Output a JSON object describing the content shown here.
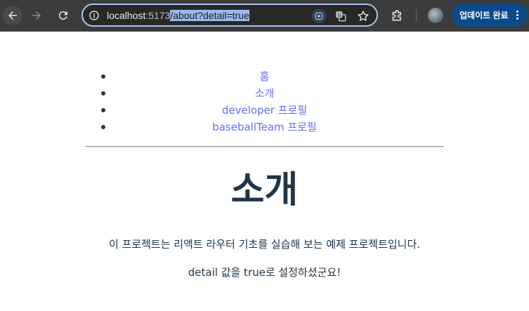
{
  "browser": {
    "url_host": "localhost",
    "url_port": ":5173",
    "url_path": "/about?detail=true",
    "update_button": "업데이트 완료",
    "icons": [
      "back-arrow-icon",
      "forward-arrow-icon",
      "reload-icon",
      "info-icon",
      "lens-icon",
      "translate-icon",
      "star-icon",
      "extensions-icon",
      "avatar",
      "kebab-menu-icon"
    ],
    "accent": "#0b4a8b"
  },
  "nav": {
    "items": [
      {
        "label": "홈"
      },
      {
        "label": "소개"
      },
      {
        "label": "developer 프로필"
      },
      {
        "label": "baseballTeam 프로필"
      }
    ],
    "link_color": "#646cff"
  },
  "main": {
    "title": "소개",
    "description": "이 프로젝트는 리액트 라우터 기초를 실습해 보는 예제 프로젝트입니다.",
    "detail_message": "detail 값을 true로 설정하셨군요!"
  }
}
